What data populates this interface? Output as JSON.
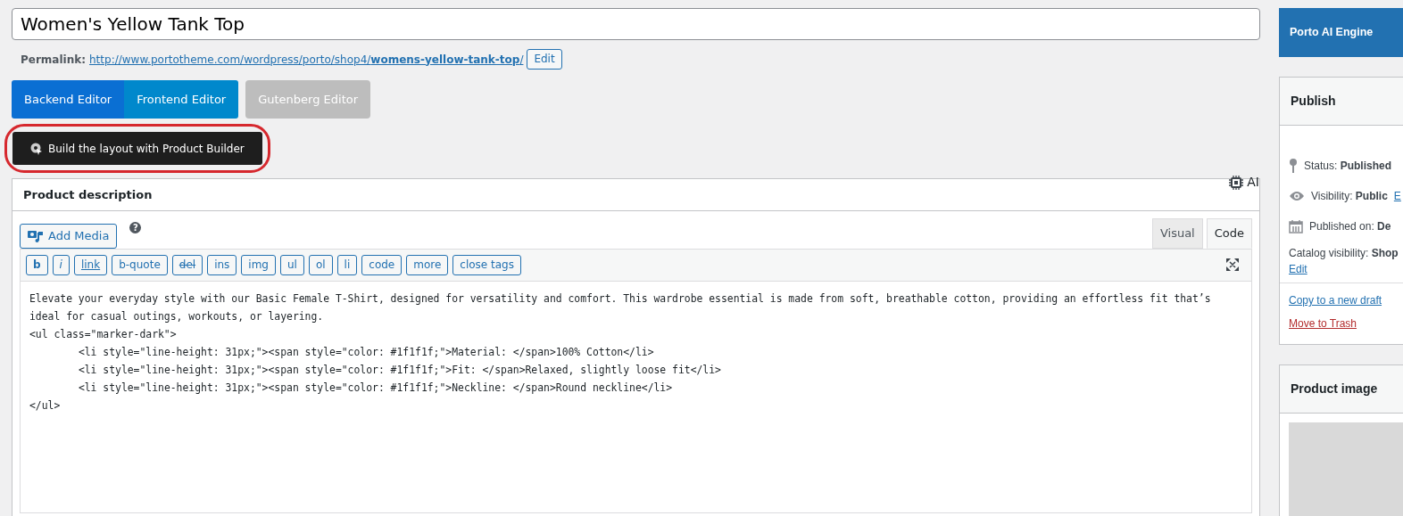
{
  "title_field": {
    "value": "Women's Yellow Tank Top"
  },
  "permalink": {
    "label": "Permalink:",
    "url_base": "http://www.portotheme.com/wordpress/porto/shop4/",
    "slug": "womens-yellow-tank-top",
    "url_end": "/",
    "edit": "Edit"
  },
  "editor_buttons": [
    {
      "label": "Backend Editor",
      "selected": true
    },
    {
      "label": "Frontend Editor",
      "selected": false
    }
  ],
  "gutenberg_button": {
    "label": "Gutenberg Editor"
  },
  "builder_button": {
    "label": "Build the layout with Product Builder",
    "highlighted": true
  },
  "description_box": {
    "title": "Product description",
    "ai_label": "AI",
    "add_media": "Add Media",
    "help": "?",
    "tabs": [
      {
        "label": "Visual",
        "selected": false
      },
      {
        "label": "Code",
        "selected": true
      }
    ],
    "quicktags": [
      {
        "label": "b",
        "kind": "bold"
      },
      {
        "label": "i",
        "kind": "italic"
      },
      {
        "label": "link",
        "kind": "underline"
      },
      {
        "label": "b-quote",
        "kind": "plain"
      },
      {
        "label": "del",
        "kind": "strike"
      },
      {
        "label": "ins",
        "kind": "plain"
      },
      {
        "label": "img",
        "kind": "plain"
      },
      {
        "label": "ul",
        "kind": "plain"
      },
      {
        "label": "ol",
        "kind": "plain"
      },
      {
        "label": "li",
        "kind": "plain"
      },
      {
        "label": "code",
        "kind": "plain"
      },
      {
        "label": "more",
        "kind": "plain"
      },
      {
        "label": "close tags",
        "kind": "plain"
      }
    ],
    "content_lines": [
      "Elevate your everyday style with our Basic Female T-Shirt, designed for versatility and comfort. This wardrobe essential is made from soft, breathable cotton, providing an effortless fit that’s ideal for casual outings, workouts, or layering.",
      "<ul class=\"marker-dark\">",
      "        <li style=\"line-height: 31px;\"><span style=\"color: #1f1f1f;\">Material: </span>100% Cotton</li>",
      "        <li style=\"line-height: 31px;\"><span style=\"color: #1f1f1f;\">Fit: </span>Relaxed, slightly loose fit</li>",
      "        <li style=\"line-height: 31px;\"><span style=\"color: #1f1f1f;\">Neckline: </span>Round neckline</li>",
      "</ul>"
    ]
  },
  "sidebar": {
    "ai_engine": "Porto AI Engine",
    "publish": {
      "title": "Publish",
      "rows": [
        {
          "kind": "pin",
          "label": "Status:",
          "value": "Published",
          "link": ""
        },
        {
          "kind": "eye",
          "label": "Visibility:",
          "value": "Public",
          "link": "E"
        },
        {
          "kind": "calendar",
          "label": "Published on:",
          "value": "De",
          "link": ""
        }
      ],
      "catalog": {
        "label": "Catalog visibility:",
        "value": "Shop",
        "link": "Edit"
      },
      "copy_link": "Copy to a new draft",
      "trash_link": "Move to Trash"
    },
    "product_image": {
      "title": "Product image"
    }
  }
}
